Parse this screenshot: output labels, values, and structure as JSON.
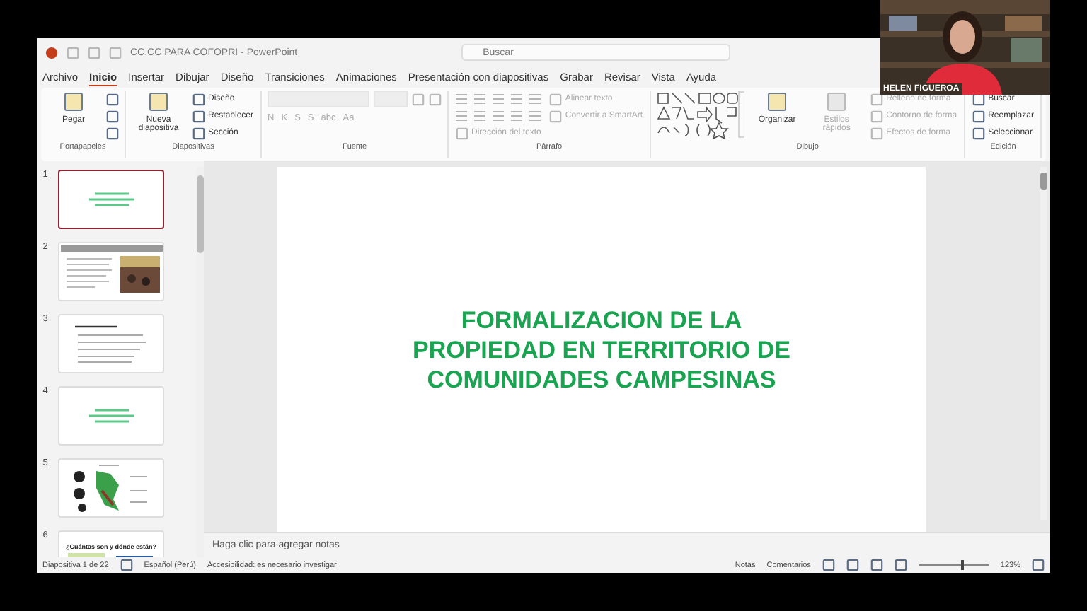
{
  "title_bar": {
    "title": "CC.CC PARA COFOPRI - PowerPoint",
    "search": {
      "placeholder": "Buscar"
    }
  },
  "menu_tabs": [
    {
      "label": "Archivo",
      "selected": false
    },
    {
      "label": "Inicio",
      "selected": true
    },
    {
      "label": "Insertar",
      "selected": false
    },
    {
      "label": "Dibujar",
      "selected": false
    },
    {
      "label": "Diseño",
      "selected": false
    },
    {
      "label": "Transiciones",
      "selected": false
    },
    {
      "label": "Animaciones",
      "selected": false
    },
    {
      "label": "Presentación con diapositivas",
      "selected": false
    },
    {
      "label": "Grabar",
      "selected": false
    },
    {
      "label": "Revisar",
      "selected": false
    },
    {
      "label": "Vista",
      "selected": false
    },
    {
      "label": "Ayuda",
      "selected": false
    }
  ],
  "ribbon_groups": [
    {
      "title": "Portapapeles",
      "items": [
        {
          "kind": "large",
          "label": "Pegar",
          "disabled": false
        },
        {
          "kind": "icon",
          "disabled": false
        },
        {
          "kind": "icon",
          "disabled": false
        },
        {
          "kind": "icon",
          "disabled": false
        }
      ]
    },
    {
      "title": "Diapositivas",
      "items": [
        {
          "kind": "large",
          "label": "Nueva diapositiva",
          "disabled": false
        },
        {
          "kind": "small",
          "label": "Diseño",
          "disabled": false
        },
        {
          "kind": "small",
          "label": "Restablecer",
          "disabled": false
        },
        {
          "kind": "small",
          "label": "Sección",
          "disabled": false
        }
      ]
    },
    {
      "title": "Fuente",
      "items": [
        {
          "kind": "fields",
          "disabled": true
        },
        {
          "kind": "glyphs",
          "glyphs": [
            "N",
            "K",
            "S",
            "S",
            "abc",
            "Aa"
          ],
          "disabled": true
        }
      ]
    },
    {
      "title": "Párrafo",
      "items": [
        {
          "kind": "paragraph",
          "disabled": true
        },
        {
          "kind": "paragraph",
          "disabled": true
        },
        {
          "kind": "small",
          "label": "Dirección del texto",
          "disabled": true
        },
        {
          "kind": "small",
          "label": "Alinear texto",
          "disabled": true
        },
        {
          "kind": "small",
          "label": "Convertir a SmartArt",
          "disabled": true
        }
      ]
    },
    {
      "title": "Dibujo",
      "items": [
        {
          "kind": "shapes",
          "disabled": false
        },
        {
          "kind": "large",
          "label": "Organizar",
          "disabled": false
        },
        {
          "kind": "large",
          "label": "Estilos rápidos",
          "disabled": true
        },
        {
          "kind": "small",
          "label": "Relleno de forma",
          "disabled": true
        },
        {
          "kind": "small",
          "label": "Contorno de forma",
          "disabled": true
        },
        {
          "kind": "small",
          "label": "Efectos de forma",
          "disabled": true
        }
      ]
    },
    {
      "title": "Edición",
      "items": [
        {
          "kind": "small",
          "label": "Buscar",
          "disabled": false
        },
        {
          "kind": "small",
          "label": "Reemplazar",
          "disabled": false
        },
        {
          "kind": "small",
          "label": "Seleccionar",
          "disabled": false
        }
      ]
    }
  ],
  "thumbnails": [
    {
      "number": "1",
      "selected": true,
      "kind": "title"
    },
    {
      "number": "2",
      "selected": false
    },
    {
      "number": "3",
      "selected": false,
      "kind": "text"
    },
    {
      "number": "4",
      "selected": false,
      "kind": "title"
    },
    {
      "number": "5",
      "selected": false,
      "kind": "map"
    },
    {
      "number": "6",
      "selected": false,
      "kind": "heading",
      "heading": "¿Cuántas son y dónde están?"
    }
  ],
  "slide": {
    "title_lines": [
      "FORMALIZACION DE LA",
      "PROPIEDAD EN TERRITORIO DE",
      "COMUNIDADES CAMPESINAS"
    ]
  },
  "notes": {
    "placeholder": "Haga clic para agregar notas"
  },
  "status_bar": {
    "slide_count": "Diapositiva 1 de 22",
    "language": "Español (Perú)",
    "accessibility": "Accesibilidad: es necesario investigar",
    "notes": "Notas",
    "comments": "Comentarios",
    "zoom": "123%",
    "level": 0.6
  },
  "webcam": {
    "name": "HELEN FIGUEROA"
  }
}
